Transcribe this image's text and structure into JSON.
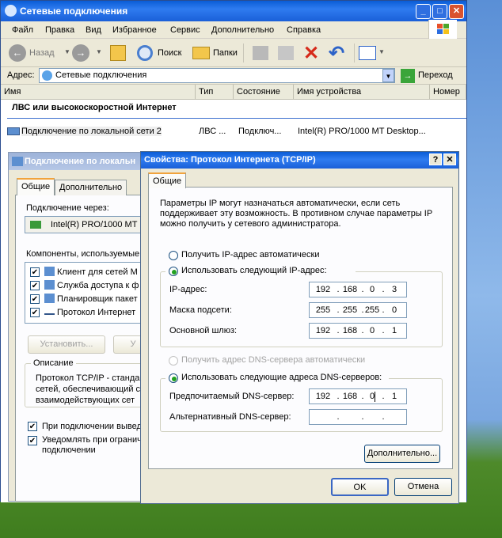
{
  "explorer": {
    "title": "Сетевые подключения",
    "menu": [
      "Файл",
      "Правка",
      "Вид",
      "Избранное",
      "Сервис",
      "Дополнительно",
      "Справка"
    ],
    "toolbar": {
      "back": "Назад",
      "search": "Поиск",
      "folders": "Папки"
    },
    "address": {
      "label": "Адрес:",
      "value": "Сетевые подключения",
      "go": "Переход"
    },
    "columns": [
      "Имя",
      "Тип",
      "Состояние",
      "Имя устройства",
      "Номер"
    ],
    "group_header": "ЛВС или высокоскоростной Интернет",
    "row": {
      "name": "Подключение по локальной сети 2",
      "type": "ЛВС ...",
      "status": "Подключ...",
      "device": "Intel(R) PRO/1000 MT Desktop..."
    }
  },
  "lan_dialog": {
    "title": "Подключение по локальн",
    "tabs": [
      "Общие",
      "Дополнительно"
    ],
    "connect_via_label": "Подключение через:",
    "adapter": "Intel(R) PRO/1000 MT I",
    "components_label": "Компоненты, используемые",
    "components": [
      "Клиент для сетей M",
      "Служба доступа к ф",
      "Планировщик пакет",
      "Протокол Интернет"
    ],
    "install_button": "Установить...",
    "uninstall_button": "У",
    "description_label": "Описание",
    "description_text": "Протокол TCP/IP - станда сетей, обеспечивающий с взаимодействующих сет",
    "show_icon_label": "При подключении выведи",
    "notify_label": "Уведомлять при ограничи подключении"
  },
  "tcp_dialog": {
    "title": "Свойства: Протокол Интернета (TCP/IP)",
    "help": "?",
    "close": "✕",
    "tab": "Общие",
    "intro": "Параметры IP могут назначаться автоматически, если сеть поддерживает эту возможность. В противном случае параметры IP можно получить у сетевого администратора.",
    "ip_auto_label": "Получить IP-адрес автоматически",
    "ip_manual_label": "Использовать следующий IP-адрес:",
    "ip_label": "IP-адрес:",
    "ip": [
      "192",
      "168",
      "0",
      "3"
    ],
    "mask_label": "Маска подсети:",
    "mask": [
      "255",
      "255",
      "255",
      "0"
    ],
    "gateway_label": "Основной шлюз:",
    "gateway": [
      "192",
      "168",
      "0",
      "1"
    ],
    "dns_auto_label": "Получить адрес DNS-сервера автоматически",
    "dns_manual_label": "Использовать следующие адреса DNS-серверов:",
    "dns_pref_label": "Предпочитаемый DNS-сервер:",
    "dns_pref": [
      "192",
      "168",
      "0",
      "1"
    ],
    "dns_alt_label": "Альтернативный DNS-сервер:",
    "dns_alt": [
      "",
      "",
      "",
      ""
    ],
    "advanced_button": "Дополнительно...",
    "ok_button": "OK",
    "cancel_button": "Отмена"
  }
}
